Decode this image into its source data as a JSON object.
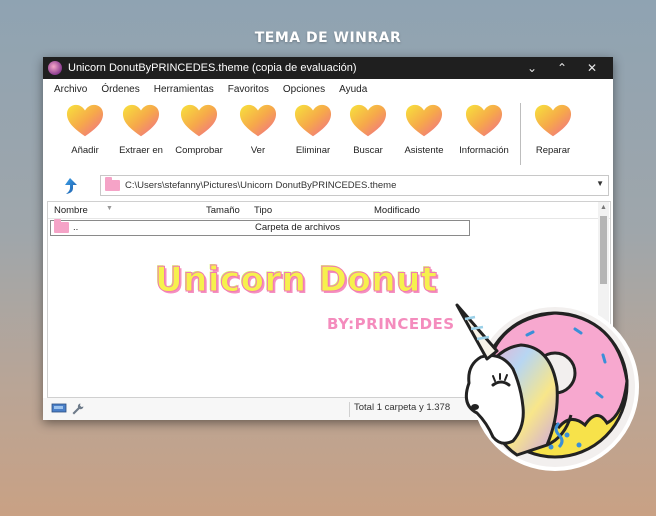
{
  "banner": {
    "text": "TEMA DE WINRAR"
  },
  "window": {
    "title": "Unicorn DonutByPRINCEDES.theme (copia de evaluación)",
    "controls": {
      "minimize": "⌄",
      "maximize": "⌃",
      "close": "✕"
    }
  },
  "menu": [
    "Archivo",
    "Órdenes",
    "Herramientas",
    "Favoritos",
    "Opciones",
    "Ayuda"
  ],
  "toolbar": {
    "buttons": [
      "Añadir",
      "Extraer en",
      "Comprobar",
      "Ver",
      "Eliminar",
      "Buscar",
      "Asistente",
      "Información",
      "Reparar"
    ],
    "icon": "heart-icon",
    "icon_colors": {
      "top": "#f7e23c",
      "bottom": "#f06a8e"
    }
  },
  "address": {
    "path": "C:\\Users\\stefanny\\Pictures\\Unicorn DonutByPRINCEDES.theme"
  },
  "filelist": {
    "columns": [
      "Nombre",
      "Tamaño",
      "Tipo",
      "Modificado"
    ],
    "rows": [
      {
        "name": "..",
        "size": "",
        "type": "Carpeta de archivos",
        "modified": ""
      }
    ]
  },
  "logo": {
    "title": "Unicorn Donut",
    "subtitle": "BY:PRINCEDES"
  },
  "status": {
    "text": "Total 1 carpeta y 1.378"
  },
  "colors": {
    "folder": "#f5a3c7",
    "titlebar": "#1f1f1f",
    "accent_pink": "#f48cbd",
    "accent_yellow": "#f6f14d"
  }
}
